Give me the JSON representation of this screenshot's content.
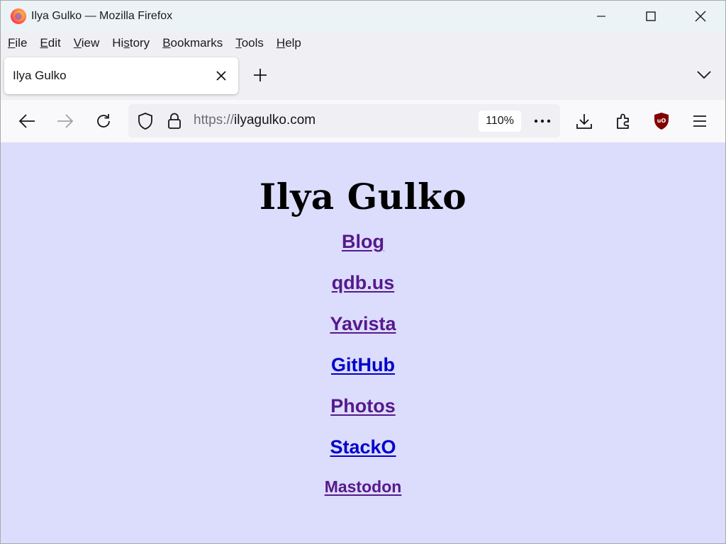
{
  "window": {
    "title": "Ilya Gulko — Mozilla Firefox"
  },
  "menu": {
    "file": {
      "ul": "F",
      "rest": "ile"
    },
    "edit": {
      "ul": "E",
      "rest": "dit"
    },
    "view": {
      "ul": "V",
      "rest": "iew"
    },
    "history": {
      "pre": "Hi",
      "ul": "s",
      "rest": "tory"
    },
    "bookmarks": {
      "ul": "B",
      "rest": "ookmarks"
    },
    "tools": {
      "ul": "T",
      "rest": "ools"
    },
    "help": {
      "ul": "H",
      "rest": "elp"
    }
  },
  "tab": {
    "title": "Ilya Gulko"
  },
  "urlbar": {
    "scheme": "https://",
    "host": "ilyagulko.com",
    "zoom": "110%"
  },
  "page": {
    "title": "Ilya Gulko",
    "links": [
      {
        "label": "Blog",
        "visited": true
      },
      {
        "label": "qdb.us",
        "visited": true
      },
      {
        "label": "Yavista",
        "visited": true
      },
      {
        "label": "GitHub",
        "visited": false
      },
      {
        "label": "Photos",
        "visited": true
      },
      {
        "label": "StackO",
        "visited": false
      },
      {
        "label": "Mastodon",
        "visited": true
      }
    ]
  },
  "colors": {
    "page_background": "#dcdcfd",
    "visited_link": "#551a8b",
    "unvisited_link": "#0000cc",
    "ublock_shield": "#800000"
  },
  "icons": {
    "app": "firefox-icon",
    "minimize": "minimize-icon",
    "maximize": "maximize-icon",
    "close": "close-icon",
    "tab_close": "close-icon",
    "new_tab": "plus-icon",
    "tab_list": "chevron-down-icon",
    "back": "back-arrow-icon",
    "forward": "forward-arrow-icon",
    "reload": "reload-icon",
    "tracking": "shield-icon",
    "lock": "lock-icon",
    "page_actions": "more-icon",
    "downloads": "download-icon",
    "extensions": "puzzle-icon",
    "ublock": "ublock-icon",
    "app_menu": "hamburger-menu-icon"
  }
}
